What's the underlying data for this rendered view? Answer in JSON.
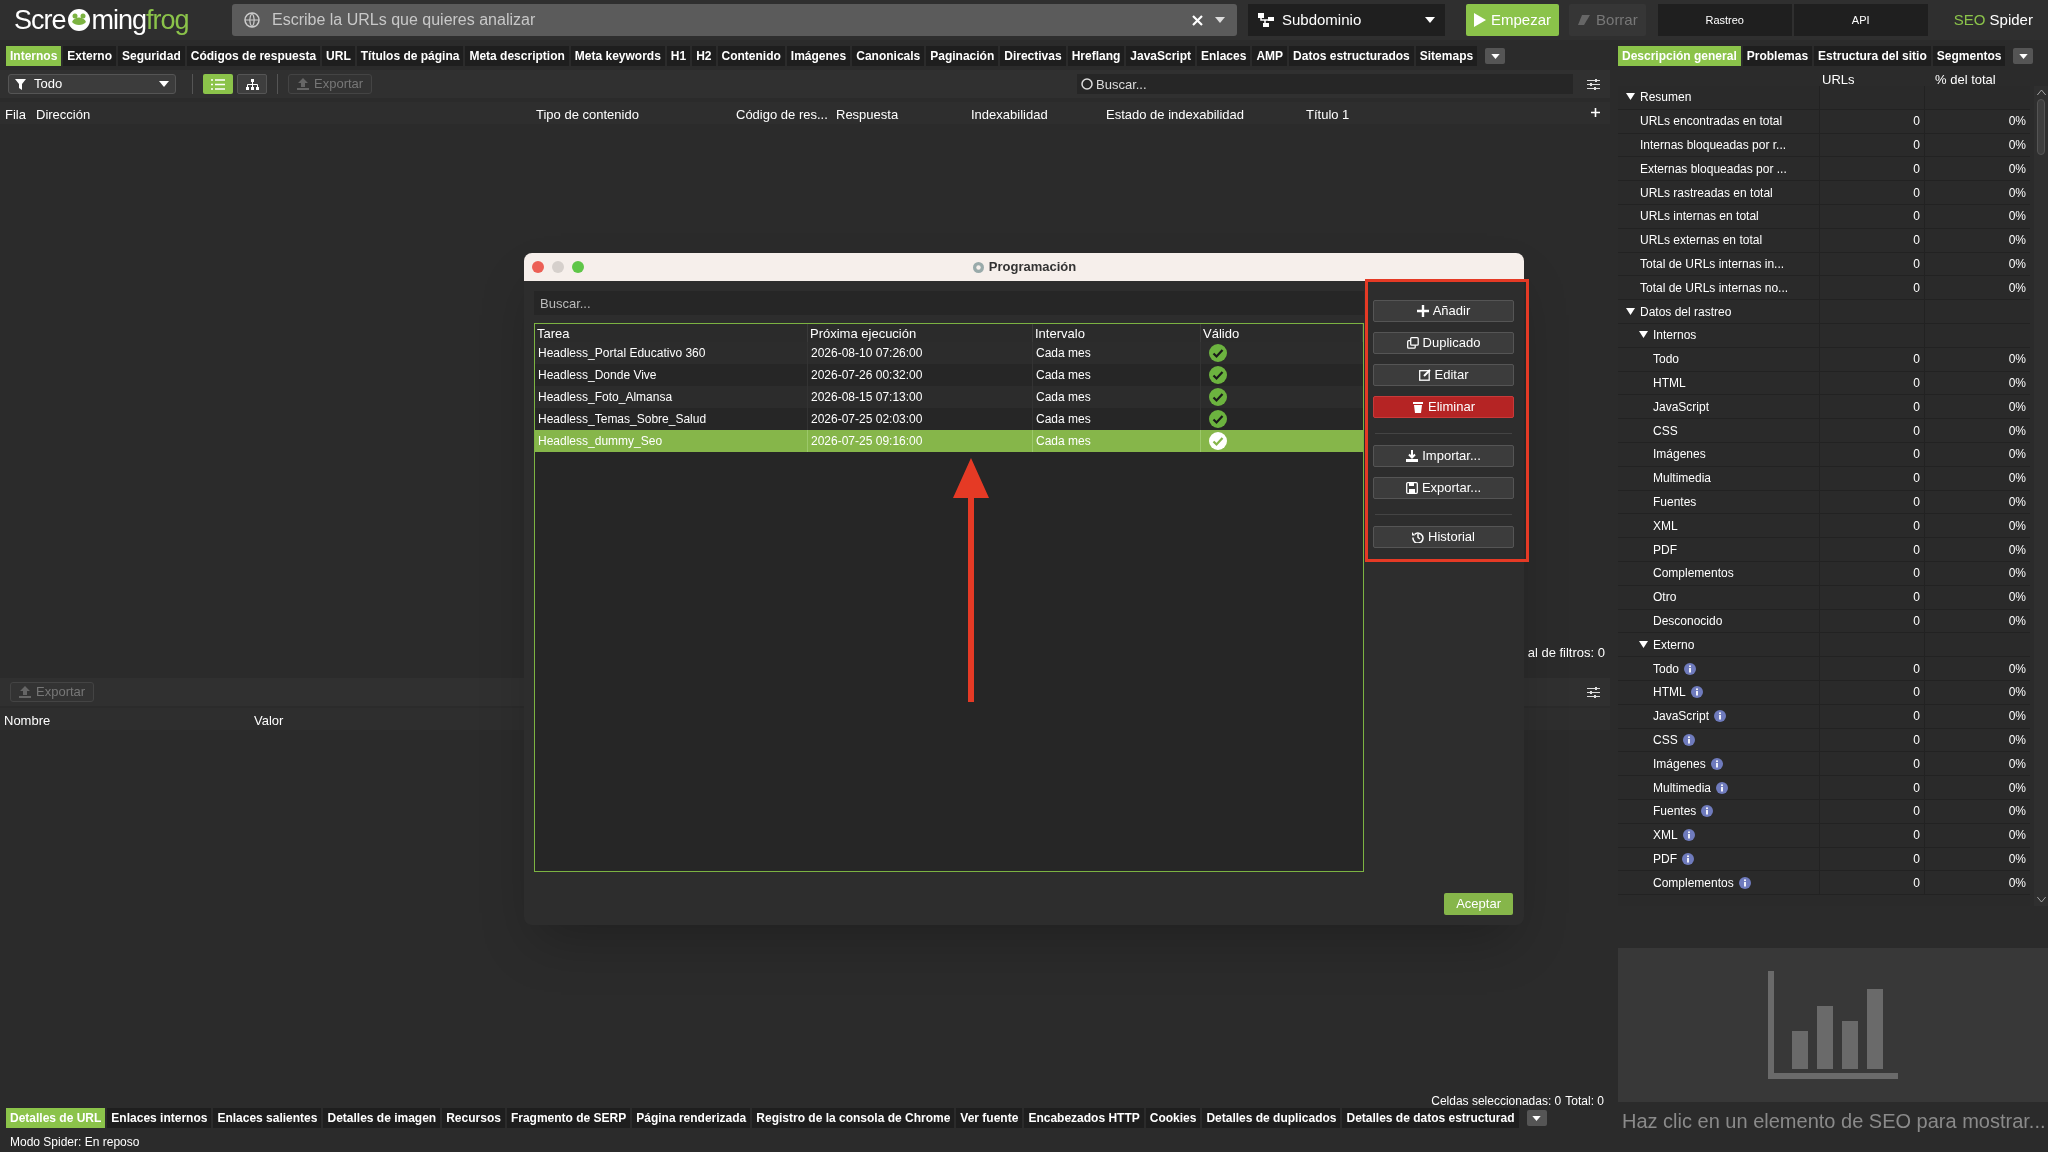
{
  "top_bar": {
    "logo": {
      "before": "Scre",
      "middle": "ming",
      "accent": "frog"
    },
    "url_field": {
      "placeholder": "Escribe la URLs que quieres analizar"
    },
    "scope_dropdown": {
      "value": "Subdominio"
    },
    "actions": [
      {
        "label": "Empezar",
        "kind": "primary",
        "disabled": false
      },
      {
        "label": "Borrar",
        "kind": "plain",
        "disabled": true
      }
    ],
    "mode_tabs": [
      {
        "label": "Rastreo"
      },
      {
        "label": "API"
      }
    ],
    "product": {
      "accent": "SEO",
      "rest": "Spider"
    }
  },
  "main_tabs": [
    {
      "label": "Internos",
      "selected": true
    },
    {
      "label": "Externo",
      "selected": false
    },
    {
      "label": "Seguridad",
      "selected": false
    },
    {
      "label": "Códigos de respuesta",
      "selected": false
    },
    {
      "label": "URL",
      "selected": false
    },
    {
      "label": "Títulos de página",
      "selected": false
    },
    {
      "label": "Meta description",
      "selected": false
    },
    {
      "label": "Meta keywords",
      "selected": false
    },
    {
      "label": "H1",
      "selected": false
    },
    {
      "label": "H2",
      "selected": false
    },
    {
      "label": "Contenido",
      "selected": false
    },
    {
      "label": "Imágenes",
      "selected": false
    },
    {
      "label": "Canonicals",
      "selected": false
    },
    {
      "label": "Paginación",
      "selected": false
    },
    {
      "label": "Directivas",
      "selected": false
    },
    {
      "label": "Hreflang",
      "selected": false
    },
    {
      "label": "JavaScript",
      "selected": false
    },
    {
      "label": "Enlaces",
      "selected": false
    },
    {
      "label": "AMP",
      "selected": false
    },
    {
      "label": "Datos estructurados",
      "selected": false
    },
    {
      "label": "Sitemaps",
      "selected": false
    }
  ],
  "toolbar": {
    "filter": "Todo",
    "views": [
      {
        "selected": true
      },
      {
        "selected": false
      }
    ],
    "export": {
      "label": "Exportar",
      "disabled": true
    },
    "search": {
      "placeholder": "Buscar..."
    }
  },
  "columns": [
    "Fila",
    "Dirección",
    "Tipo de contenido",
    "Código de res...",
    "Respuesta",
    "Indexabilidad",
    "Estado de indexabilidad",
    "Título 1"
  ],
  "filter_total": "al de filtros: 0",
  "details_panel": {
    "export": {
      "label": "Exportar",
      "disabled": true
    },
    "columns": [
      "Nombre",
      "Valor"
    ]
  },
  "selection_status": {
    "cells": "Celdas seleccionadas: 0",
    "total": "Total: 0"
  },
  "bottom_tabs": [
    {
      "label": "Detalles de URL",
      "selected": true
    },
    {
      "label": "Enlaces internos",
      "selected": false
    },
    {
      "label": "Enlaces salientes",
      "selected": false
    },
    {
      "label": "Detalles de imagen",
      "selected": false
    },
    {
      "label": "Recursos",
      "selected": false
    },
    {
      "label": "Fragmento de SERP",
      "selected": false
    },
    {
      "label": "Página renderizada",
      "selected": false
    },
    {
      "label": "Registro de la consola de Chrome",
      "selected": false
    },
    {
      "label": "Ver fuente",
      "selected": false
    },
    {
      "label": "Encabezados HTTP",
      "selected": false
    },
    {
      "label": "Cookies",
      "selected": false
    },
    {
      "label": "Detalles de duplicados",
      "selected": false
    },
    {
      "label": "Detalles de datos estructurad",
      "selected": false
    }
  ],
  "status_bar": "Modo Spider: En reposo",
  "side_panel": {
    "tabs": [
      {
        "label": "Descripción general",
        "selected": true
      },
      {
        "label": "Problemas",
        "selected": false
      },
      {
        "label": "Estructura del sitio",
        "selected": false
      },
      {
        "label": "Segmentos",
        "selected": false
      }
    ],
    "columns": [
      "URLs",
      "% del total"
    ],
    "tree": [
      {
        "label": "Resumen",
        "expanded": true,
        "children": [
          {
            "label": "URLs encontradas en total",
            "urls": "0",
            "share": "0%"
          },
          {
            "label": "Internas bloqueadas por r...",
            "urls": "0",
            "share": "0%"
          },
          {
            "label": "Externas bloqueadas por ...",
            "urls": "0",
            "share": "0%"
          },
          {
            "label": "URLs rastreadas en total",
            "urls": "0",
            "share": "0%"
          },
          {
            "label": "URLs internas en total",
            "urls": "0",
            "share": "0%"
          },
          {
            "label": "URLs externas en total",
            "urls": "0",
            "share": "0%"
          },
          {
            "label": "Total de URLs internas in...",
            "urls": "0",
            "share": "0%"
          },
          {
            "label": "Total de URLs internas no...",
            "urls": "0",
            "share": "0%"
          }
        ]
      },
      {
        "label": "Datos del rastreo",
        "expanded": true,
        "children": [
          {
            "label": "Internos",
            "expanded": true,
            "children": [
              {
                "label": "Todo",
                "urls": "0",
                "share": "0%"
              },
              {
                "label": "HTML",
                "urls": "0",
                "share": "0%"
              },
              {
                "label": "JavaScript",
                "urls": "0",
                "share": "0%"
              },
              {
                "label": "CSS",
                "urls": "0",
                "share": "0%"
              },
              {
                "label": "Imágenes",
                "urls": "0",
                "share": "0%"
              },
              {
                "label": "Multimedia",
                "urls": "0",
                "share": "0%"
              },
              {
                "label": "Fuentes",
                "urls": "0",
                "share": "0%"
              },
              {
                "label": "XML",
                "urls": "0",
                "share": "0%"
              },
              {
                "label": "PDF",
                "urls": "0",
                "share": "0%"
              },
              {
                "label": "Complementos",
                "urls": "0",
                "share": "0%"
              },
              {
                "label": "Otro",
                "urls": "0",
                "share": "0%"
              },
              {
                "label": "Desconocido",
                "urls": "0",
                "share": "0%"
              }
            ]
          },
          {
            "label": "Externo",
            "expanded": true,
            "children": [
              {
                "label": "Todo",
                "urls": "0",
                "share": "0%",
                "info": true
              },
              {
                "label": "HTML",
                "urls": "0",
                "share": "0%",
                "info": true
              },
              {
                "label": "JavaScript",
                "urls": "0",
                "share": "0%",
                "info": true
              },
              {
                "label": "CSS",
                "urls": "0",
                "share": "0%",
                "info": true
              },
              {
                "label": "Imágenes",
                "urls": "0",
                "share": "0%",
                "info": true
              },
              {
                "label": "Multimedia",
                "urls": "0",
                "share": "0%",
                "info": true
              },
              {
                "label": "Fuentes",
                "urls": "0",
                "share": "0%",
                "info": true
              },
              {
                "label": "XML",
                "urls": "0",
                "share": "0%",
                "info": true
              },
              {
                "label": "PDF",
                "urls": "0",
                "share": "0%",
                "info": true
              },
              {
                "label": "Complementos",
                "urls": "0",
                "share": "0%",
                "info": true
              }
            ]
          }
        ]
      }
    ],
    "chart_hint": "Haz clic en un elemento de SEO para mostrar..."
  },
  "dialog": {
    "title": "Programación",
    "search": {
      "placeholder": "Buscar..."
    },
    "columns": [
      "Tarea",
      "Próxima ejecución",
      "Intervalo",
      "Válido"
    ],
    "rows": [
      {
        "task": "Headless_Portal Educativo 360",
        "next_run": "2026-08-10 07:26:00",
        "interval": "Cada mes",
        "valid": true,
        "selected": false
      },
      {
        "task": "Headless_Donde Vive",
        "next_run": "2026-07-26 00:32:00",
        "interval": "Cada mes",
        "valid": true,
        "selected": false
      },
      {
        "task": "Headless_Foto_Almansa",
        "next_run": "2026-08-15 07:13:00",
        "interval": "Cada mes",
        "valid": true,
        "selected": false
      },
      {
        "task": "Headless_Temas_Sobre_Salud",
        "next_run": "2026-07-25 02:03:00",
        "interval": "Cada mes",
        "valid": true,
        "selected": false
      },
      {
        "task": "Headless_dummy_Seo",
        "next_run": "2026-07-25 09:16:00",
        "interval": "Cada mes",
        "valid": true,
        "selected": true
      }
    ],
    "button_groups": [
      [
        {
          "label": "Añadir",
          "kind": "default"
        },
        {
          "label": "Duplicado",
          "kind": "default"
        },
        {
          "label": "Editar",
          "kind": "default"
        },
        {
          "label": "Eliminar",
          "kind": "danger"
        }
      ],
      [
        {
          "label": "Importar...",
          "kind": "default"
        },
        {
          "label": "Exportar...",
          "kind": "default"
        }
      ],
      [
        {
          "label": "Historial",
          "kind": "default"
        }
      ]
    ],
    "confirm": "Aceptar"
  }
}
